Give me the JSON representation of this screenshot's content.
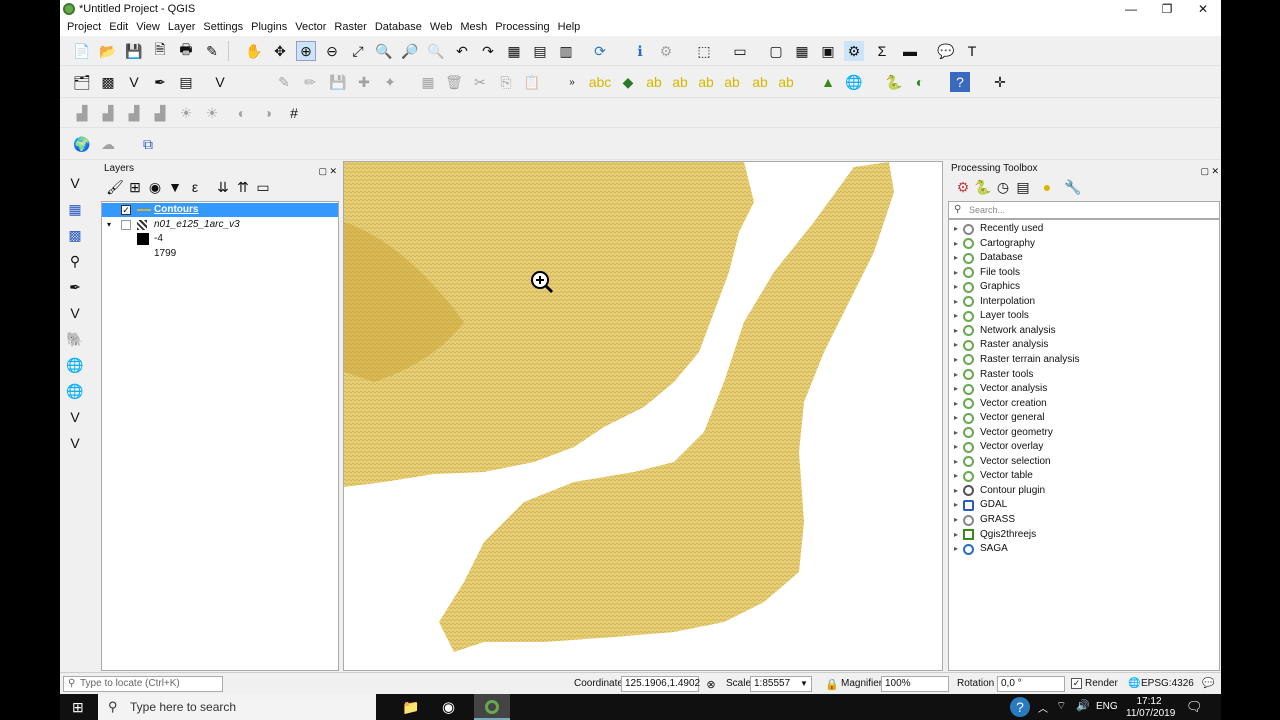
{
  "window": {
    "title": "*Untitled Project - QGIS",
    "controls": {
      "minimize": "—",
      "restore": "❐",
      "close": "✕"
    }
  },
  "menu": [
    "Project",
    "Edit",
    "View",
    "Layer",
    "Settings",
    "Plugins",
    "Vector",
    "Raster",
    "Database",
    "Web",
    "Mesh",
    "Processing",
    "Help"
  ],
  "layers_panel": {
    "title": "Layers",
    "layers": [
      {
        "name": "Contours",
        "checked": true,
        "selected": true
      },
      {
        "name": "n01_e125_1arc_v3",
        "checked": false,
        "selected": false
      }
    ],
    "legend": {
      "min": "-4",
      "max": "1799"
    }
  },
  "processing": {
    "title": "Processing Toolbox",
    "search_placeholder": "Search...",
    "items": [
      "Recently used",
      "Cartography",
      "Database",
      "File tools",
      "Graphics",
      "Interpolation",
      "Layer tools",
      "Network analysis",
      "Raster analysis",
      "Raster terrain analysis",
      "Raster tools",
      "Vector analysis",
      "Vector creation",
      "Vector general",
      "Vector geometry",
      "Vector overlay",
      "Vector selection",
      "Vector table",
      "Contour plugin",
      "GDAL",
      "GRASS",
      "Qgis2threejs",
      "SAGA"
    ]
  },
  "statusbar": {
    "locate_placeholder": "Type to locate (Ctrl+K)",
    "coordinate_label": "Coordinate",
    "coordinate": "125.1906,1.4902",
    "scale_label": "Scale",
    "scale": "1:85557",
    "magnifier_label": "Magnifier",
    "magnifier": "100%",
    "rotation_label": "Rotation",
    "rotation": "0,0 °",
    "render_label": "Render",
    "crs": "EPSG:4326"
  },
  "taskbar": {
    "search_placeholder": "Type here to search",
    "lang": "ENG",
    "time": "17:12",
    "date": "11/07/2019"
  },
  "colors": {
    "accent": "#3399ff",
    "contour": "#d4b040",
    "qgis_green": "#6aa84f"
  }
}
